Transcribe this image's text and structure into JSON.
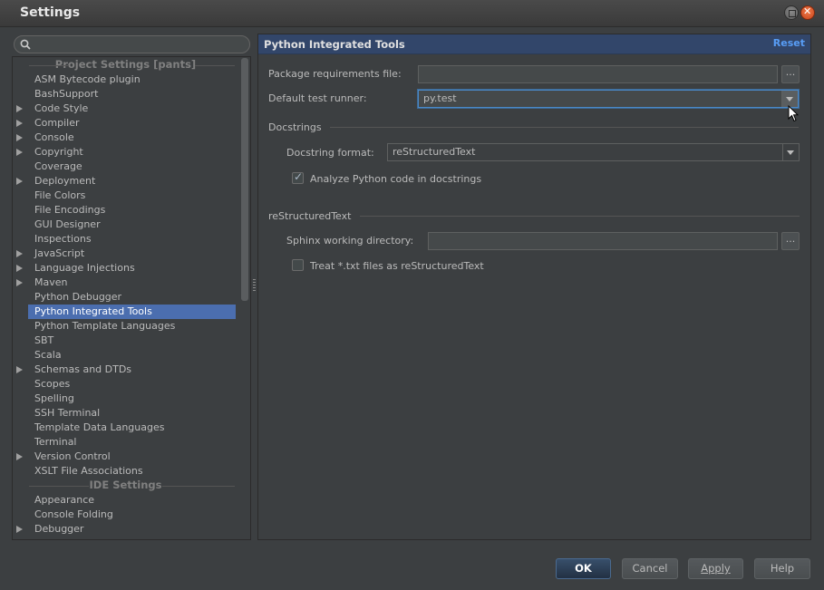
{
  "window": {
    "title": "Settings"
  },
  "search": {
    "placeholder": ""
  },
  "tree": {
    "project_header": "Project Settings [pants]",
    "ide_header": "IDE Settings",
    "items": [
      {
        "label": "ASM Bytecode plugin",
        "expandable": false
      },
      {
        "label": "BashSupport",
        "expandable": false
      },
      {
        "label": "Code Style",
        "expandable": true
      },
      {
        "label": "Compiler",
        "expandable": true
      },
      {
        "label": "Console",
        "expandable": true
      },
      {
        "label": "Copyright",
        "expandable": true
      },
      {
        "label": "Coverage",
        "expandable": false
      },
      {
        "label": "Deployment",
        "expandable": true
      },
      {
        "label": "File Colors",
        "expandable": false
      },
      {
        "label": "File Encodings",
        "expandable": false
      },
      {
        "label": "GUI Designer",
        "expandable": false
      },
      {
        "label": "Inspections",
        "expandable": false
      },
      {
        "label": "JavaScript",
        "expandable": true
      },
      {
        "label": "Language Injections",
        "expandable": true
      },
      {
        "label": "Maven",
        "expandable": true
      },
      {
        "label": "Python Debugger",
        "expandable": false
      },
      {
        "label": "Python Integrated Tools",
        "expandable": false,
        "selected": true
      },
      {
        "label": "Python Template Languages",
        "expandable": false
      },
      {
        "label": "SBT",
        "expandable": false
      },
      {
        "label": "Scala",
        "expandable": false
      },
      {
        "label": "Schemas and DTDs",
        "expandable": true
      },
      {
        "label": "Scopes",
        "expandable": false
      },
      {
        "label": "Spelling",
        "expandable": false
      },
      {
        "label": "SSH Terminal",
        "expandable": false
      },
      {
        "label": "Template Data Languages",
        "expandable": false
      },
      {
        "label": "Terminal",
        "expandable": false
      },
      {
        "label": "Version Control",
        "expandable": true
      },
      {
        "label": "XSLT File Associations",
        "expandable": false
      }
    ],
    "ide_items": [
      {
        "label": "Appearance",
        "expandable": false
      },
      {
        "label": "Console Folding",
        "expandable": false
      },
      {
        "label": "Debugger",
        "expandable": true
      }
    ]
  },
  "panel": {
    "title": "Python Integrated Tools",
    "reset": "Reset",
    "package_req_label": "Package requirements file:",
    "package_req_value": "",
    "test_runner_label": "Default test runner:",
    "test_runner_value": "py.test",
    "docstrings_header": "Docstrings",
    "docstring_format_label": "Docstring format:",
    "docstring_format_value": "reStructuredText",
    "analyze_label": "Analyze Python code in docstrings",
    "analyze_checked": true,
    "rst_header": "reStructuredText",
    "sphinx_label": "Sphinx working directory:",
    "sphinx_value": "",
    "treat_txt_label": "Treat *.txt files as reStructuredText",
    "treat_txt_checked": false,
    "ellipsis": "..."
  },
  "buttons": {
    "ok": "OK",
    "cancel": "Cancel",
    "apply": "Apply",
    "help": "Help"
  },
  "colors": {
    "selection": "#4b6eaf",
    "link": "#589df6",
    "header_bg": "#32466a",
    "background": "#3c3f41"
  }
}
